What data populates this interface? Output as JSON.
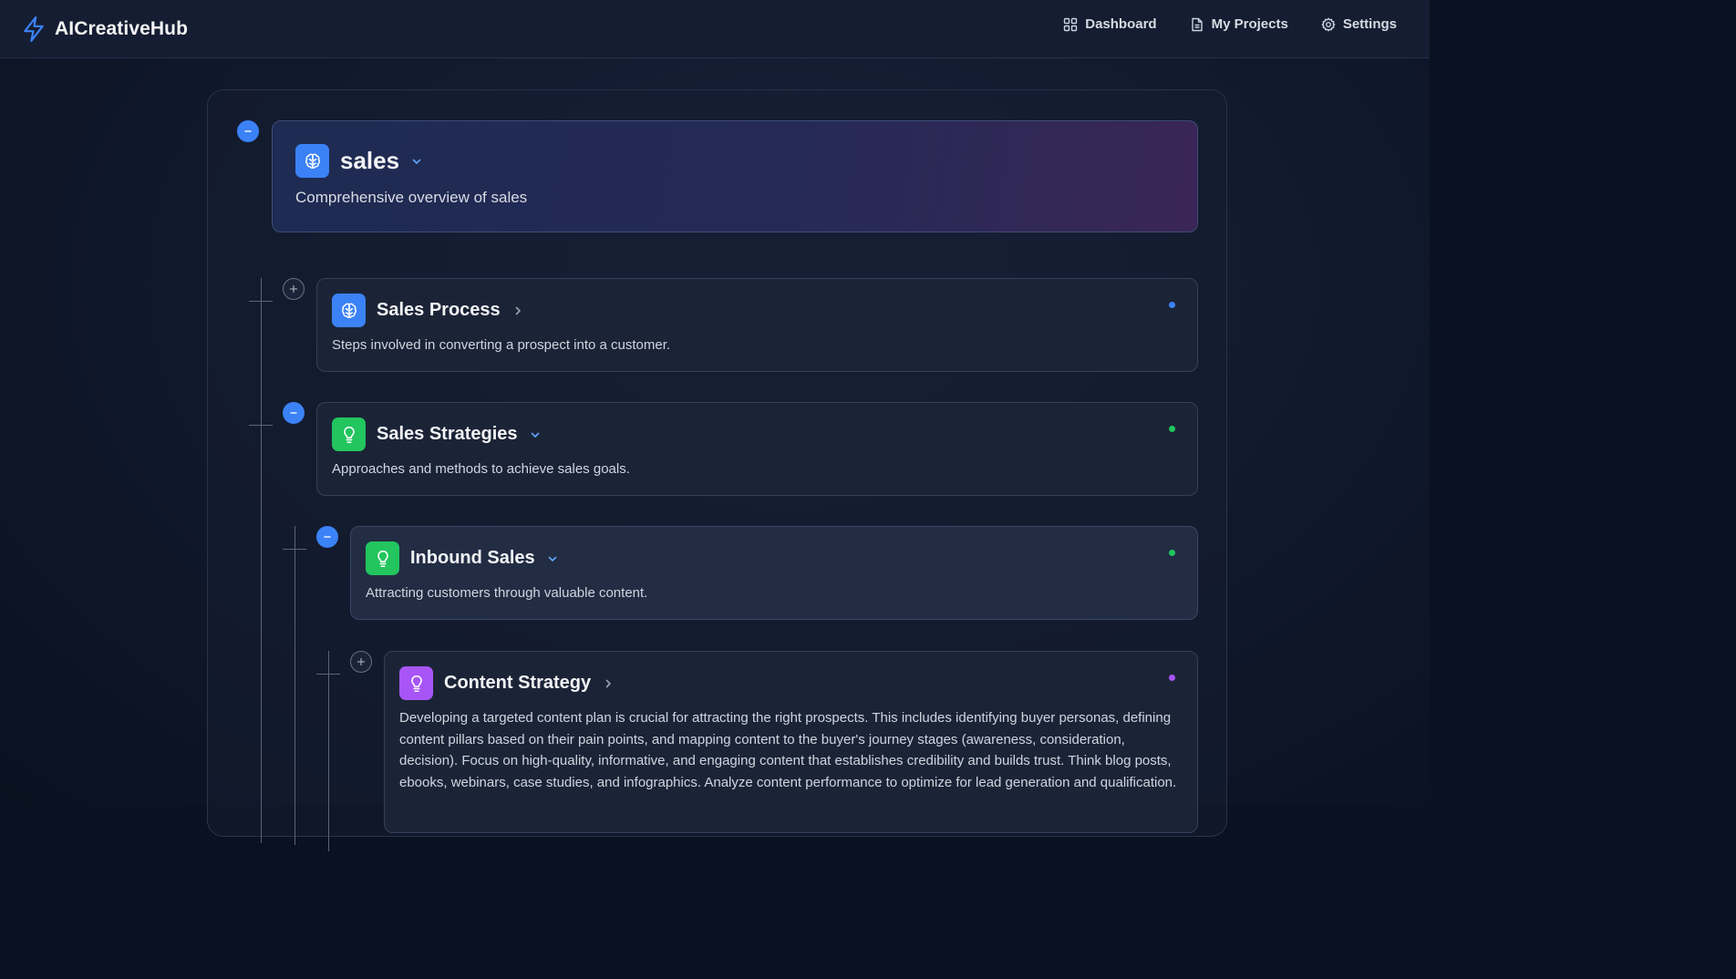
{
  "app": {
    "name": "AICreativeHub",
    "accent": "#3b82f6"
  },
  "nav": {
    "items": [
      {
        "label": "Dashboard",
        "icon": "grid-icon"
      },
      {
        "label": "My Projects",
        "icon": "document-icon"
      },
      {
        "label": "Settings",
        "icon": "gear-icon"
      }
    ]
  },
  "tree": {
    "root": {
      "title": "sales",
      "description": "Comprehensive overview of sales",
      "icon": "brain-icon",
      "expanded": true
    },
    "nodes": [
      {
        "title": "Sales Process",
        "description": "Steps involved in converting a prospect into a customer.",
        "icon": "brain-icon",
        "icon_color": "#3b82f6",
        "status_color": "#3b82f6",
        "expanded": false
      },
      {
        "title": "Sales Strategies",
        "description": "Approaches and methods to achieve sales goals.",
        "icon": "lightbulb-icon",
        "icon_color": "#22c55e",
        "status_color": "#22c55e",
        "expanded": true
      },
      {
        "title": "Inbound Sales",
        "description": "Attracting customers through valuable content.",
        "icon": "lightbulb-icon",
        "icon_color": "#22c55e",
        "status_color": "#22c55e",
        "expanded": true
      },
      {
        "title": "Content Strategy",
        "description": "Developing a targeted content plan is crucial for attracting the right prospects. This includes identifying buyer personas, defining content pillars based on their pain points, and mapping content to the buyer's journey stages (awareness, consideration, decision). Focus on high-quality, informative, and engaging content that establishes credibility and builds trust. Think blog posts, ebooks, webinars, case studies, and infographics. Analyze content performance to optimize for lead generation and qualification.",
        "icon": "lightbulb-icon",
        "icon_color": "#a855f7",
        "status_color": "#a855f7",
        "expanded": false
      }
    ]
  }
}
